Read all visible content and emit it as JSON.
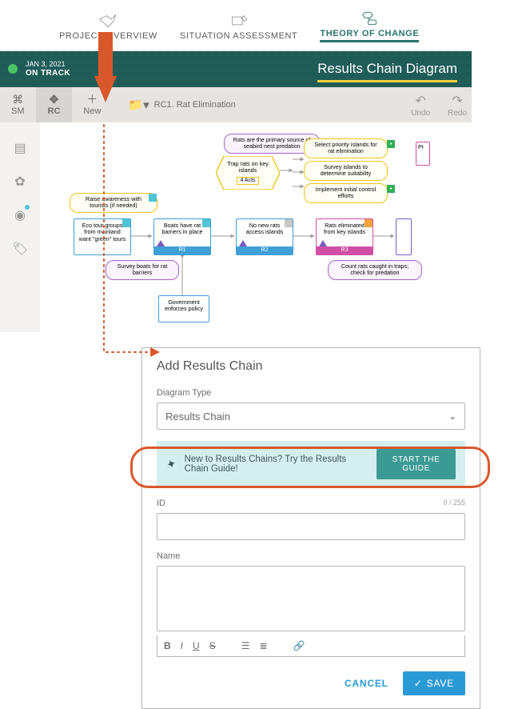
{
  "tabs": {
    "project": "PROJECT OVERVIEW",
    "situation": "SITUATION ASSESSMENT",
    "theory": "THEORY OF CHANGE"
  },
  "status": {
    "date": "JAN 3, 2021",
    "state": "ON TRACK"
  },
  "page_title": "Results Chain Diagram",
  "toolbar": {
    "sm": "SM",
    "rc": "RC",
    "new": "New",
    "crumb": "RC1. Rat Elimination",
    "undo": "Undo",
    "redo": "Redo"
  },
  "sidetools": [
    "page-icon",
    "puzzle-icon",
    "eye-icon",
    "tag-icon"
  ],
  "diagram": {
    "top_note": "Rats are the primary source of seabird nest predation",
    "hex": {
      "title": "Trap rats on key islands",
      "acts": "4 Acts"
    },
    "priority_pills": [
      "Select priority islands for rat elimination",
      "Survey islands to determine suitability",
      "Implement initial control efforts"
    ],
    "awareness": "Raise awareness with tourists (if needed)",
    "eco": "Eco tour groups from mainland want \"green\" tours",
    "boats": {
      "text": "Boats have rat barriers in place",
      "tag": "R1"
    },
    "nonew": {
      "text": "No new rats access islands",
      "tag": "R2"
    },
    "elim": {
      "text": "Rats eliminated from key islands",
      "tag": "R3"
    },
    "survey_boats": "Survey boats for rat barriers",
    "gov": "Government enforces policy",
    "count": "Count rats caught in traps; check for predation",
    "pr_cut": "Pr"
  },
  "modal": {
    "title": "Add Results Chain",
    "type_label": "Diagram Type",
    "type_value": "Results Chain",
    "guide_text": "New to Results Chains? Try the Results Chain Guide!",
    "guide_btn": "START THE GUIDE",
    "id_label": "ID",
    "id_counter": "0 / 255",
    "name_label": "Name",
    "cancel": "CANCEL",
    "save": "SAVE"
  }
}
